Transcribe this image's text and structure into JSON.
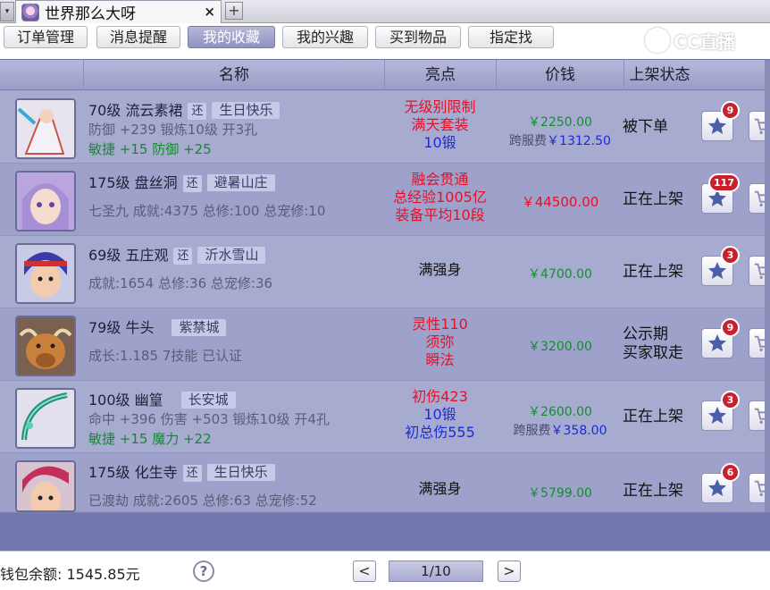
{
  "window": {
    "tab_title": "世界那么大呀",
    "close_glyph": "×",
    "new_tab_glyph": "+",
    "dropdown_glyph": "▾"
  },
  "nav": {
    "buttons": [
      "订单管理",
      "消息提醒",
      "我的收藏",
      "我的兴趣",
      "买到物品",
      "指定找"
    ],
    "active_index": 2
  },
  "logo": {
    "text": "CC直播"
  },
  "table": {
    "headers": [
      "名称",
      "亮点",
      "价钱",
      "上架状态"
    ],
    "rows": [
      {
        "level_name": "70级  流云素裙",
        "tags": [
          "还",
          "生日快乐"
        ],
        "attr1": "防御 +239 锻炼10级 开3孔",
        "attr2": "敏捷 +15 防御 +25",
        "highlights": [
          {
            "text": "无级别限制",
            "color": "red"
          },
          {
            "text": "满天套装",
            "color": "red"
          },
          {
            "text": "10锻",
            "color": "blue"
          }
        ],
        "price": "￥2250.00",
        "fee_label": "跨服费",
        "fee_value": "￥1312.50",
        "status": "被下单",
        "fav_count": "9"
      },
      {
        "level_name": "175级  盘丝洞",
        "tags": [
          "还",
          "避暑山庄"
        ],
        "attr1": "七圣九 成就:4375 总修:100 总宠修:10",
        "attr2": "",
        "highlights": [
          {
            "text": "融会贯通",
            "color": "red"
          },
          {
            "text": "总经验1005亿",
            "color": "red"
          },
          {
            "text": "装备平均10段",
            "color": "red"
          }
        ],
        "price": "￥44500.00",
        "fee_label": "",
        "fee_value": "",
        "status": "正在上架",
        "fav_count": "117"
      },
      {
        "level_name": "69级  五庄观",
        "tags": [
          "还",
          "沂水雪山"
        ],
        "attr1": "成就:1654 总修:36 总宠修:36",
        "attr2": "",
        "highlights": [
          {
            "text": "满强身",
            "color": "dark"
          }
        ],
        "price": "￥4700.00",
        "fee_label": "",
        "fee_value": "",
        "status": "正在上架",
        "fav_count": "3"
      },
      {
        "level_name": "79级  牛头",
        "tags": [
          "紫禁城"
        ],
        "attr1": "成长:1.185 7技能 已认证",
        "attr2": "",
        "highlights": [
          {
            "text": "灵性110",
            "color": "red"
          },
          {
            "text": "须弥",
            "color": "red"
          },
          {
            "text": "瞬法",
            "color": "red"
          }
        ],
        "price": "￥3200.00",
        "fee_label": "",
        "fee_value": "",
        "status": "公示期\n买家取走",
        "fav_count": "9"
      },
      {
        "level_name": "100级  幽篁",
        "tags": [
          "长安城"
        ],
        "attr1": "命中 +396 伤害 +503 锻炼10级 开4孔",
        "attr2": "敏捷 +15 魔力 +22",
        "highlights": [
          {
            "text": "初伤423",
            "color": "red"
          },
          {
            "text": "10锻",
            "color": "blue"
          },
          {
            "text": "初总伤555",
            "color": "blue"
          }
        ],
        "price": "￥2600.00",
        "fee_label": "跨服费",
        "fee_value": "￥358.00",
        "status": "正在上架",
        "fav_count": "3"
      },
      {
        "level_name": "175级  化生寺",
        "tags": [
          "还",
          "生日快乐"
        ],
        "attr1": "已渡劫 成就:2605 总修:63 总宠修:52",
        "attr2": "",
        "highlights": [
          {
            "text": "满强身",
            "color": "dark"
          }
        ],
        "price": "￥5799.00",
        "fee_label": "",
        "fee_value": "",
        "status": "正在上架",
        "fav_count": "6"
      }
    ]
  },
  "footer": {
    "wallet": "钱包余额: 1545.85元",
    "help_glyph": "?",
    "prev_glyph": "<",
    "next_glyph": ">",
    "page": "1/10"
  },
  "colors": {
    "panel": "#a2a5cc",
    "price_green": "#10902a",
    "highlight_red": "#e5102a",
    "highlight_blue": "#1a2ad8",
    "badge_red": "#c8202c"
  },
  "icons": {
    "favorite": "star-icon",
    "cart": "cart-icon",
    "help": "help-icon"
  }
}
